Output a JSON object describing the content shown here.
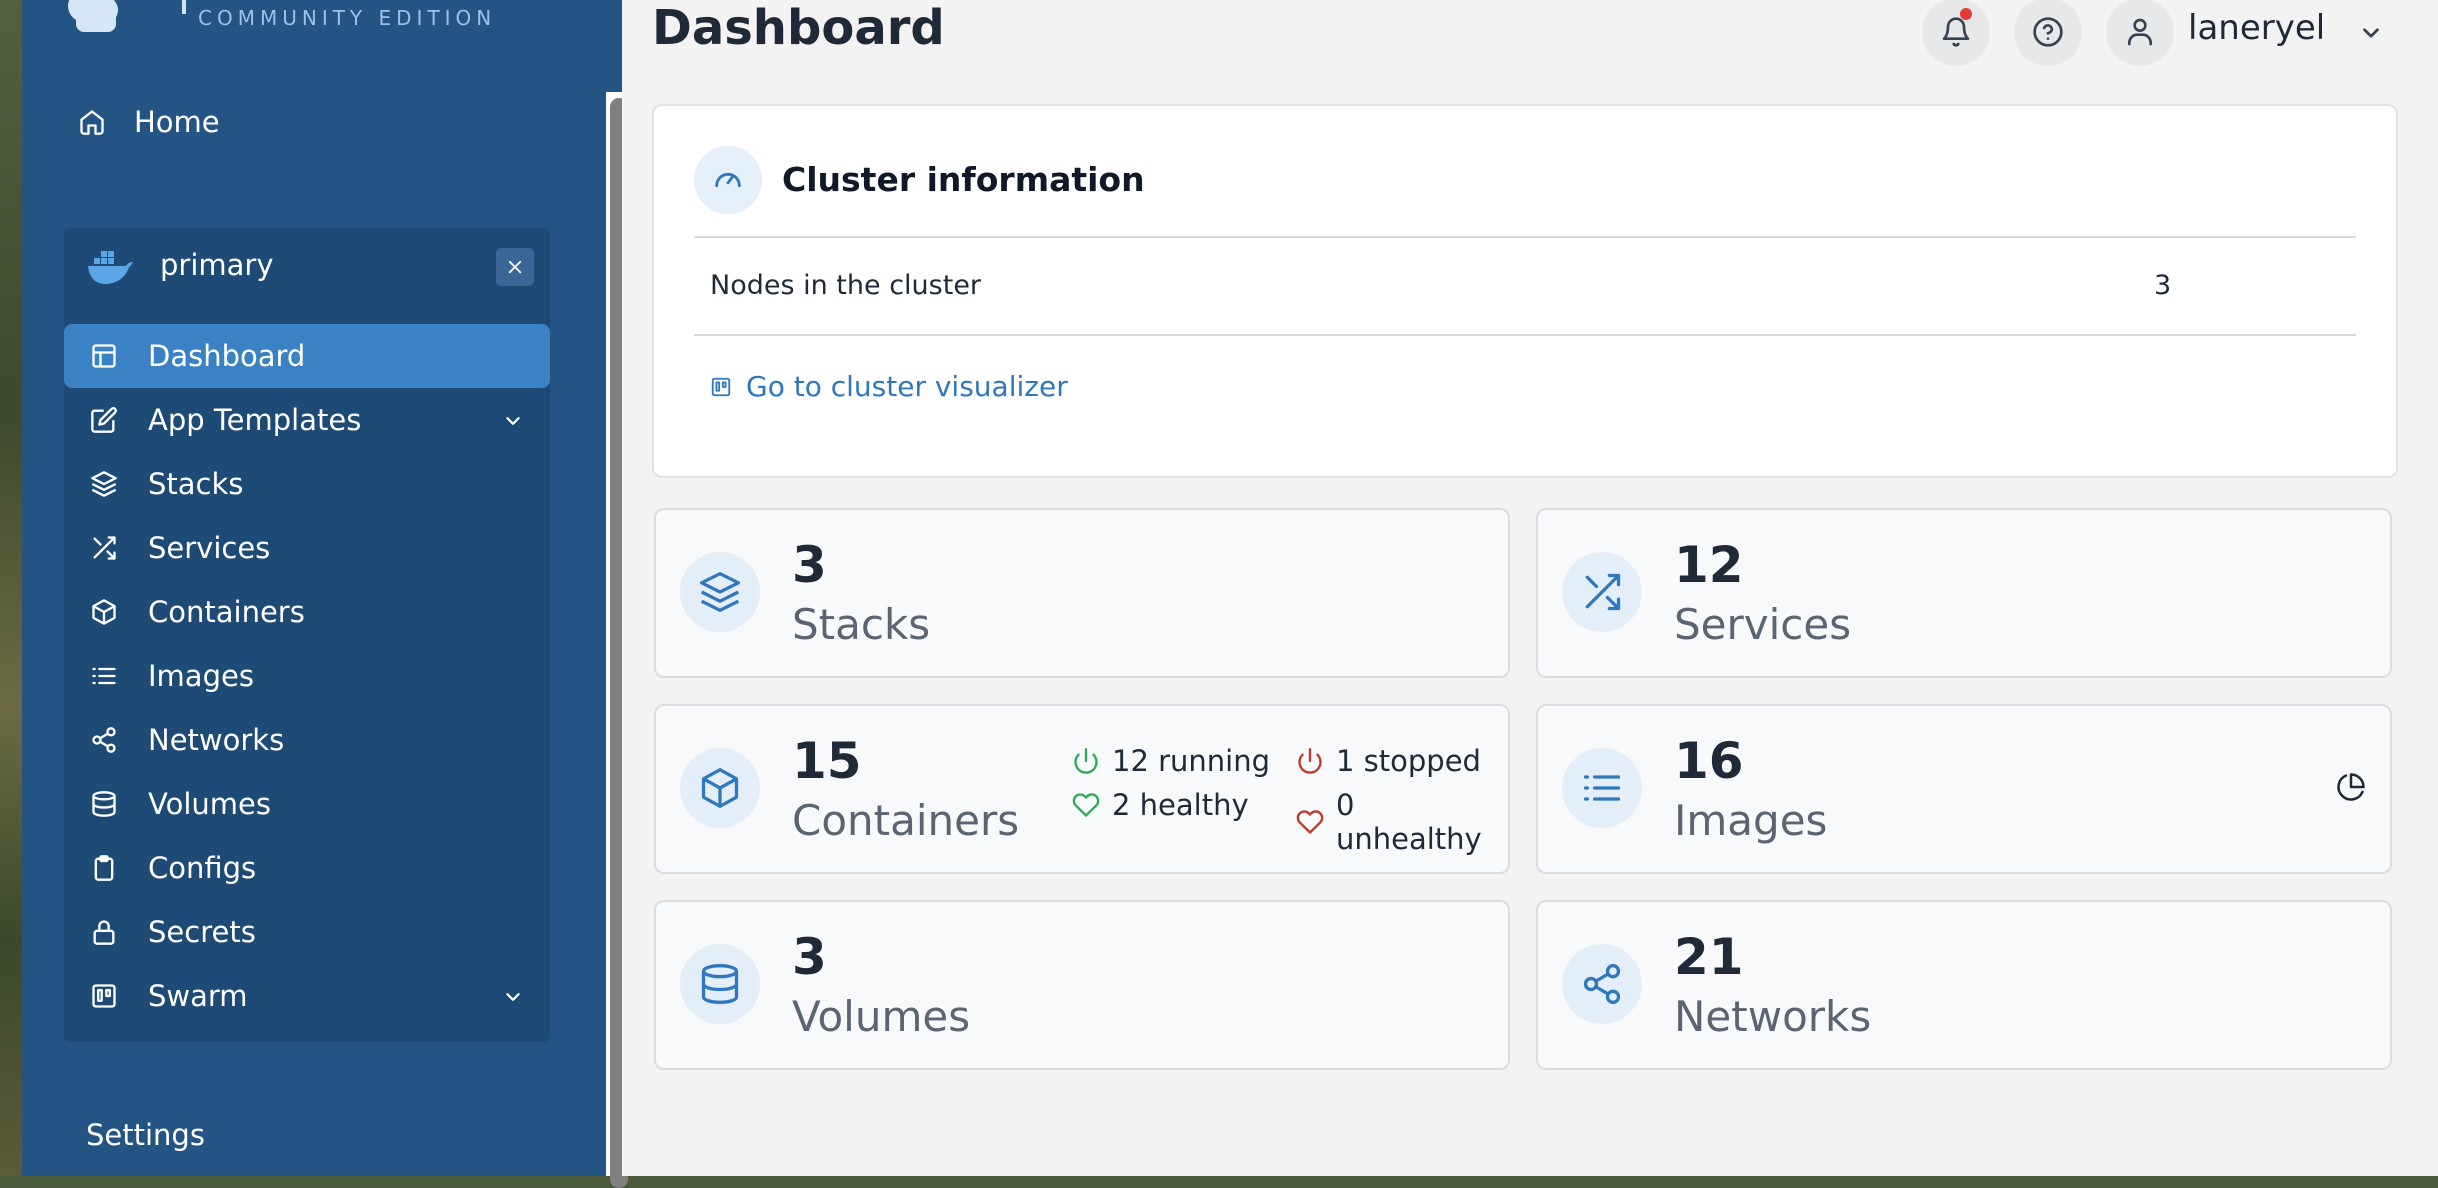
{
  "brand": {
    "edition": "COMMUNITY EDITION"
  },
  "sidebar": {
    "home_label": "Home",
    "environment": {
      "name": "primary"
    },
    "items": [
      {
        "label": "Dashboard",
        "icon": "layout-icon",
        "active": true
      },
      {
        "label": "App Templates",
        "icon": "edit-icon",
        "expandable": true
      },
      {
        "label": "Stacks",
        "icon": "layers-icon"
      },
      {
        "label": "Services",
        "icon": "shuffle-icon"
      },
      {
        "label": "Containers",
        "icon": "box-icon"
      },
      {
        "label": "Images",
        "icon": "list-icon"
      },
      {
        "label": "Networks",
        "icon": "share-icon"
      },
      {
        "label": "Volumes",
        "icon": "database-icon"
      },
      {
        "label": "Configs",
        "icon": "clipboard-icon"
      },
      {
        "label": "Secrets",
        "icon": "lock-icon"
      },
      {
        "label": "Swarm",
        "icon": "trello-icon",
        "expandable": true
      }
    ],
    "settings_label": "Settings"
  },
  "header": {
    "title": "Dashboard",
    "user": "laneryel"
  },
  "cluster": {
    "title": "Cluster information",
    "rows": [
      {
        "label": "Nodes in the cluster",
        "value": "3"
      }
    ],
    "link": "Go to cluster visualizer"
  },
  "stats": {
    "stacks": {
      "value": "3",
      "label": "Stacks"
    },
    "services": {
      "value": "12",
      "label": "Services"
    },
    "containers": {
      "value": "15",
      "label": "Containers",
      "running": "12 running",
      "stopped": "1 stopped",
      "healthy": "2 healthy",
      "unhealthy": "0 unhealthy"
    },
    "images": {
      "value": "16",
      "label": "Images"
    },
    "volumes": {
      "value": "3",
      "label": "Volumes"
    },
    "networks": {
      "value": "21",
      "label": "Networks"
    }
  },
  "colors": {
    "sidebar": "#245483",
    "active_item": "#3b82c4",
    "accent": "#2f78bd",
    "running": "#2eaa5a",
    "stopped": "#c0392b"
  }
}
